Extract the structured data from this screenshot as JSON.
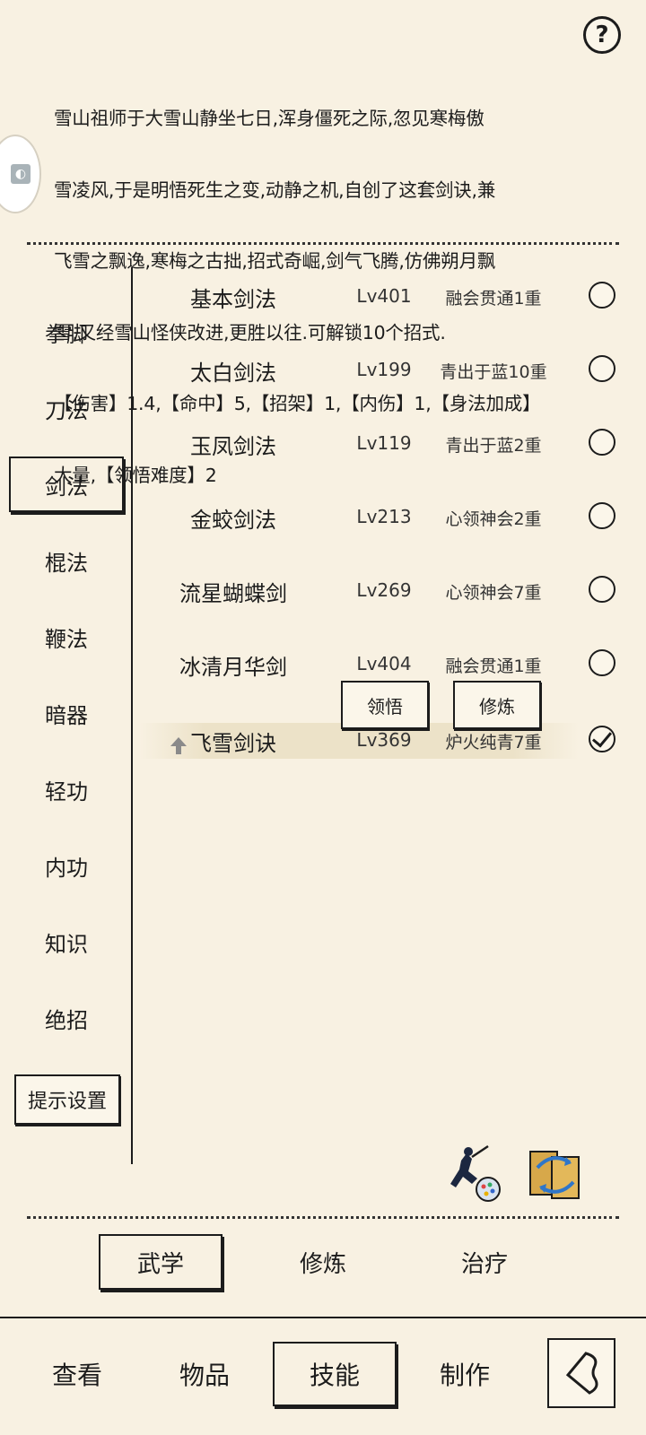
{
  "help": {
    "label": "?"
  },
  "description": {
    "lines": [
      "雪山祖师于大雪山静坐七日,浑身僵死之际,忽见寒梅傲",
      "雪凌风,于是明悟死生之变,动静之机,自创了这套剑诀,兼",
      "飞雪之飘逸,寒梅之古拙,招式奇崛,剑气飞腾,仿佛朔月飘",
      "雪,又经雪山怪侠改进,更胜以往.可解锁10个招式.",
      "【伤害】1.4,【命中】5,【招架】1,【内伤】1,【身法加成】",
      "大量,【领悟难度】2"
    ]
  },
  "categories": [
    {
      "label": "拳脚",
      "active": false
    },
    {
      "label": "刀法",
      "active": false
    },
    {
      "label": "剑法",
      "active": true
    },
    {
      "label": "棍法",
      "active": false
    },
    {
      "label": "鞭法",
      "active": false
    },
    {
      "label": "暗器",
      "active": false
    },
    {
      "label": "轻功",
      "active": false
    },
    {
      "label": "内功",
      "active": false
    },
    {
      "label": "知识",
      "active": false
    },
    {
      "label": "绝招",
      "active": false
    }
  ],
  "tip_settings": {
    "label": "提示设置"
  },
  "skills": [
    {
      "name": "基本剑法",
      "level": "Lv401",
      "stage": "融会贯通1重",
      "selected": false
    },
    {
      "name": "太白剑法",
      "level": "Lv199",
      "stage": "青出于蓝10重",
      "selected": false
    },
    {
      "name": "玉凤剑法",
      "level": "Lv119",
      "stage": "青出于蓝2重",
      "selected": false
    },
    {
      "name": "金蛟剑法",
      "level": "Lv213",
      "stage": "心领神会2重",
      "selected": false
    },
    {
      "name": "流星蝴蝶剑",
      "level": "Lv269",
      "stage": "心领神会7重",
      "selected": false
    },
    {
      "name": "冰清月华剑",
      "level": "Lv404",
      "stage": "融会贯通1重",
      "selected": false
    },
    {
      "name": "飞雪剑诀",
      "level": "Lv369",
      "stage": "炉火纯青7重",
      "selected": true
    }
  ],
  "popup": {
    "comprehend_label": "领悟",
    "train_label": "修炼"
  },
  "icons": {
    "martial_artist": "martial-artist-icon",
    "swap": "swap-icon",
    "back": "back-icon"
  },
  "tabs": [
    {
      "label": "武学",
      "active": true
    },
    {
      "label": "修炼",
      "active": false
    },
    {
      "label": "治疗",
      "active": false
    }
  ],
  "nav": [
    {
      "label": "查看",
      "active": false
    },
    {
      "label": "物品",
      "active": false
    },
    {
      "label": "技能",
      "active": true
    },
    {
      "label": "制作",
      "active": false
    }
  ],
  "colors": {
    "background": "#f8f1e2",
    "ink": "#1c1c1c",
    "highlight": "#ece2c8"
  }
}
